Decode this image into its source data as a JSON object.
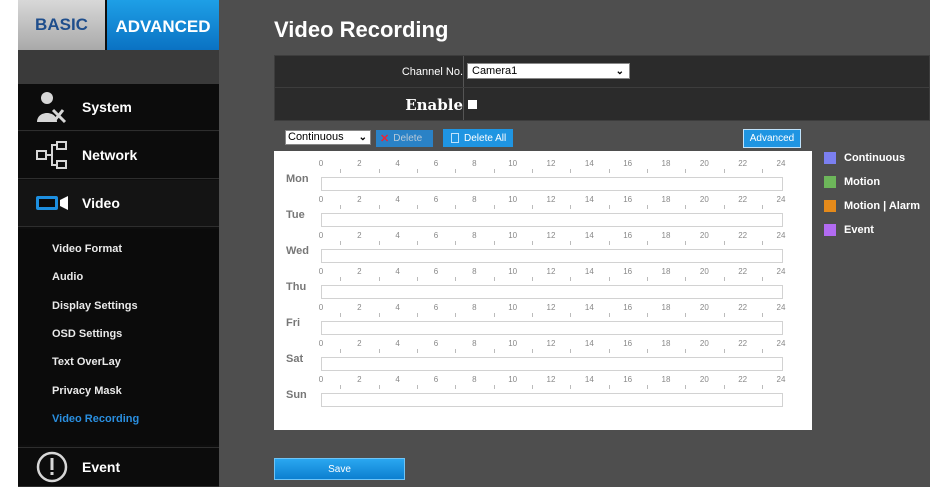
{
  "tabs": {
    "basic": "BASIC",
    "advanced": "ADVANCED"
  },
  "nav": [
    {
      "label": "System",
      "icon": "admin-tools-icon"
    },
    {
      "label": "Network",
      "icon": "network-icon"
    },
    {
      "label": "Video",
      "icon": "video-camera-icon"
    },
    {
      "label": "Event",
      "icon": "exclamation-icon"
    }
  ],
  "submenu": [
    "Video Format",
    "Audio",
    "Display Settings",
    "OSD Settings",
    "Text OverLay",
    "Privacy Mask",
    "Video Recording"
  ],
  "page": {
    "title": "Video Recording",
    "channel_label": "Channel No.",
    "channel_value": "Camera1",
    "enable_label": "Enable",
    "enable_checked": false
  },
  "toolbar": {
    "mode_value": "Continuous",
    "delete": "Delete",
    "delete_all": "Delete All",
    "advanced": "Advanced"
  },
  "schedule": {
    "days": [
      "Mon",
      "Tue",
      "Wed",
      "Thu",
      "Fri",
      "Sat",
      "Sun"
    ],
    "hours": [
      "0",
      "2",
      "4",
      "6",
      "8",
      "10",
      "12",
      "14",
      "16",
      "18",
      "20",
      "22",
      "24"
    ]
  },
  "legend": [
    {
      "label": "Continuous",
      "color": "#7b7ff0"
    },
    {
      "label": "Motion",
      "color": "#6db65a"
    },
    {
      "label": "Motion | Alarm",
      "color": "#e58a1a"
    },
    {
      "label": "Event",
      "color": "#b26bf2"
    }
  ],
  "save": "Save"
}
